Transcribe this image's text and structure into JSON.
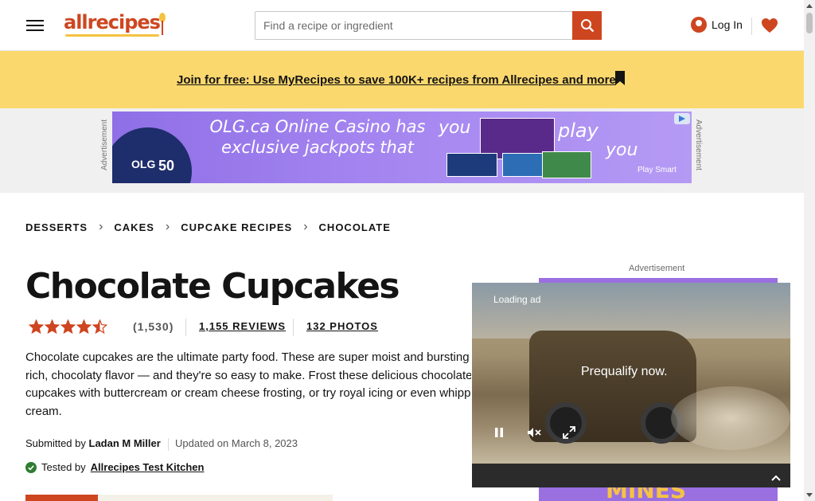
{
  "header": {
    "logo_text": "allrecipes",
    "search_placeholder": "Find a recipe or ingredient",
    "login_label": "Log In"
  },
  "promo": {
    "link_text": "Join for free: Use MyRecipes to save 100K+ recipes from Allrecipes and more"
  },
  "ad_banner": {
    "label": "Advertisement",
    "headline": "OLG.ca Online Casino has exclusive jackpots that",
    "you_1": "you",
    "play": "play",
    "you_2": "you",
    "brand_olg": "OLG",
    "brand_50": "50",
    "play_smart": "Play Smart"
  },
  "breadcrumbs": [
    "DESSERTS",
    "CAKES",
    "CUPCAKE RECIPES",
    "CHOCOLATE"
  ],
  "recipe": {
    "title": "Chocolate Cupcakes",
    "rating": 4.5,
    "rating_count": "(1,530)",
    "reviews_label": "1,155 REVIEWS",
    "photos_label": "132 PHOTOS",
    "description_lines": [
      "Chocolate cupcakes are the ultimate party food. These are super moist and bursting with",
      "rich, chocolaty flavor — and they're so easy to make. Frost these delicious chocolate",
      "cupcakes with buttercream or cream cheese frosting, or try royal icing or even whipped",
      "cream."
    ],
    "submitted_by_label": "Submitted by",
    "author": "Ladan M Miller",
    "updated": "Updated on March 8, 2023",
    "tested_by_label": "Tested by",
    "tester": "Allrecipes Test Kitchen"
  },
  "side_ad": {
    "caption": "Advertisement",
    "loading": "Loading ad",
    "video_text": "Prequalify now.",
    "bottom_text": "MINES"
  },
  "colors": {
    "brand": "#ce4620",
    "promo_bg": "#fbd86d",
    "star": "#ce4620",
    "ad_purple": "#9a6fe0"
  }
}
